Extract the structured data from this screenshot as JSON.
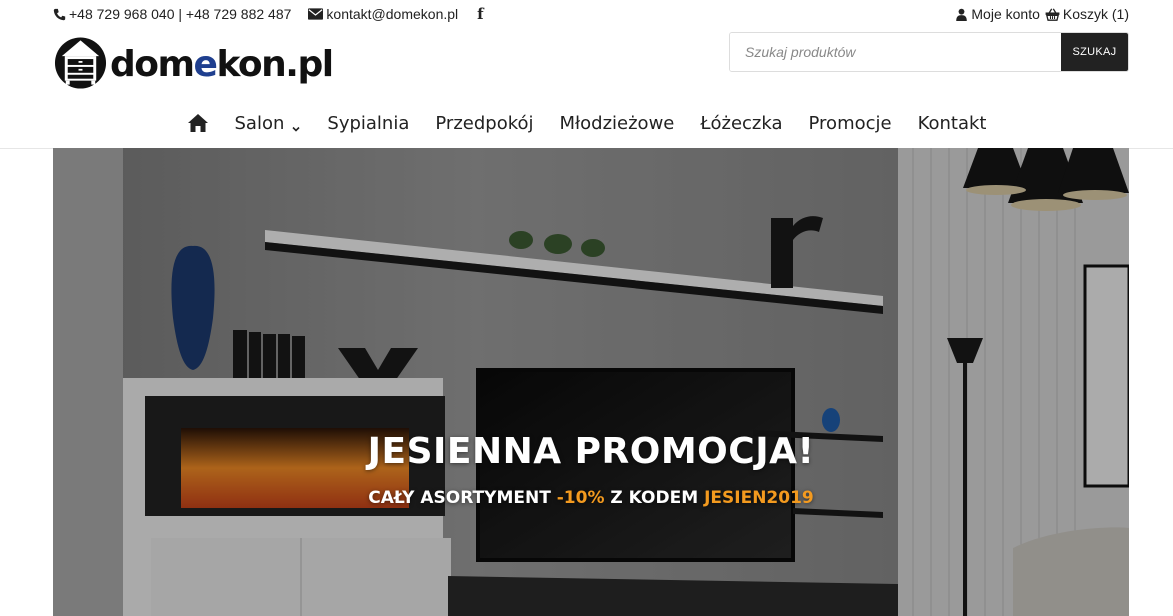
{
  "topbar": {
    "phones": "+48 729 968 040 | +48 729 882 487",
    "email": "kontakt@domekon.pl",
    "facebook_icon": "facebook-icon",
    "account": "Moje konto",
    "cart": "Koszyk (1)"
  },
  "logo": {
    "part1": "dom",
    "part2": "e",
    "part3": "kon.pl"
  },
  "search": {
    "placeholder": "Szukaj produktów",
    "button": "SZUKAJ"
  },
  "nav": {
    "home_icon": "home-icon",
    "items": [
      "Salon",
      "Sypialnia",
      "Przedpokój",
      "Młodzieżowe",
      "Łóżeczka",
      "Promocje",
      "Kontakt"
    ]
  },
  "hero": {
    "title": "JESIENNA PROMOCJA!",
    "sub_pre": "CAŁY ASORTYMENT ",
    "sub_discount": "-10%",
    "sub_mid": " Z KODEM ",
    "sub_code": "JESIEN2019"
  },
  "colors": {
    "accent": "#f39a1f",
    "brand_blue": "#1f3f8f",
    "button_dark": "#222222"
  }
}
